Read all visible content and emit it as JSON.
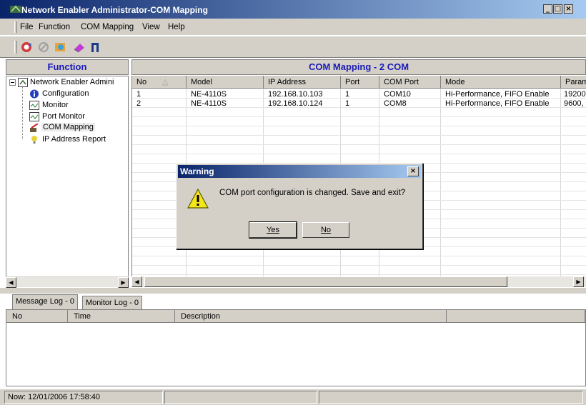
{
  "window": {
    "title": "Network Enabler Administrator-COM Mapping",
    "minimize": "_",
    "maximize": "□",
    "close": "×"
  },
  "menu": {
    "items": [
      "File",
      "Function",
      "COM Mapping",
      "View",
      "Help"
    ]
  },
  "toolbar": {
    "icons": [
      "refresh-icon",
      "disconnect-icon",
      "search-icon",
      "clear-icon",
      "apply-icon"
    ]
  },
  "function_panel": {
    "header": "Function",
    "tree": {
      "root": "Network Enabler Admini",
      "children": [
        "Configuration",
        "Monitor",
        "Port Monitor",
        "COM Mapping",
        "IP Address Report"
      ]
    }
  },
  "mapping_panel": {
    "header": "COM Mapping - 2 COM",
    "columns": [
      "No",
      "Model",
      "IP Address",
      "Port",
      "COM Port",
      "Mode",
      "Param"
    ],
    "rows": [
      {
        "no": "1",
        "model": "NE-4110S",
        "ip": "192.168.10.103",
        "port": "1",
        "com": "COM10",
        "mode": "Hi-Performance, FIFO Enable",
        "param": "19200,"
      },
      {
        "no": "2",
        "model": "NE-4110S",
        "ip": "192.168.10.124",
        "port": "1",
        "com": "COM8",
        "mode": "Hi-Performance, FIFO Enable",
        "param": "9600, I"
      }
    ]
  },
  "log_tabs": [
    "Message Log - 0",
    "Monitor Log - 0"
  ],
  "log_columns": [
    "No",
    "Time",
    "Description"
  ],
  "status": {
    "now": "Now: 12/01/2006 17:58:40"
  },
  "dialog": {
    "title": "Warning",
    "message": "COM port configuration is changed. Save and exit?",
    "yes": "Yes",
    "no": "No",
    "close": "×"
  },
  "colors": {
    "title_gradient_start": "#0a246a",
    "title_gradient_end": "#a6caf0",
    "header_text": "#1a1ab8",
    "face": "#d4d0c8"
  }
}
